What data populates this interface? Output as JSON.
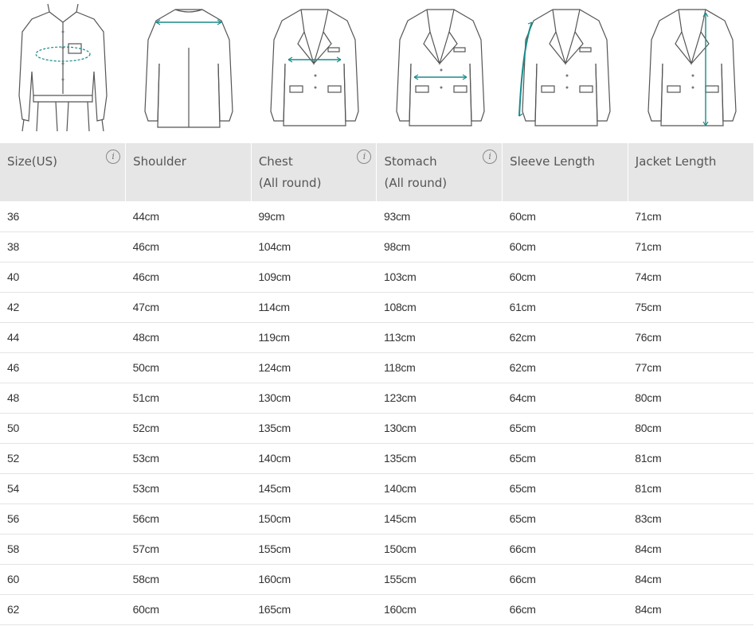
{
  "illustrations": [
    {
      "icon": "shirt-waist-icon"
    },
    {
      "icon": "jacket-back-shoulder-icon"
    },
    {
      "icon": "jacket-chest-icon"
    },
    {
      "icon": "jacket-stomach-icon"
    },
    {
      "icon": "jacket-sleeve-icon"
    },
    {
      "icon": "jacket-length-icon"
    }
  ],
  "accent_color": "#1a8a8a",
  "headers": [
    {
      "label": "Size(US)",
      "sub": "",
      "info": true
    },
    {
      "label": "Shoulder",
      "sub": "",
      "info": false
    },
    {
      "label": "Chest",
      "sub": "(All round)",
      "info": true
    },
    {
      "label": "Stomach",
      "sub": "(All round)",
      "info": true
    },
    {
      "label": "Sleeve Length",
      "sub": "",
      "info": false
    },
    {
      "label": "Jacket Length",
      "sub": "",
      "info": false
    }
  ],
  "rows": [
    [
      "36",
      "44cm",
      "99cm",
      "93cm",
      "60cm",
      "71cm"
    ],
    [
      "38",
      "46cm",
      "104cm",
      "98cm",
      "60cm",
      "71cm"
    ],
    [
      "40",
      "46cm",
      "109cm",
      "103cm",
      "60cm",
      "74cm"
    ],
    [
      "42",
      "47cm",
      "114cm",
      "108cm",
      "61cm",
      "75cm"
    ],
    [
      "44",
      "48cm",
      "119cm",
      "113cm",
      "62cm",
      "76cm"
    ],
    [
      "46",
      "50cm",
      "124cm",
      "118cm",
      "62cm",
      "77cm"
    ],
    [
      "48",
      "51cm",
      "130cm",
      "123cm",
      "64cm",
      "80cm"
    ],
    [
      "50",
      "52cm",
      "135cm",
      "130cm",
      "65cm",
      "80cm"
    ],
    [
      "52",
      "53cm",
      "140cm",
      "135cm",
      "65cm",
      "81cm"
    ],
    [
      "54",
      "53cm",
      "145cm",
      "140cm",
      "65cm",
      "81cm"
    ],
    [
      "56",
      "56cm",
      "150cm",
      "145cm",
      "65cm",
      "83cm"
    ],
    [
      "58",
      "57cm",
      "155cm",
      "150cm",
      "66cm",
      "84cm"
    ],
    [
      "60",
      "58cm",
      "160cm",
      "155cm",
      "66cm",
      "84cm"
    ],
    [
      "62",
      "60cm",
      "165cm",
      "160cm",
      "66cm",
      "84cm"
    ]
  ]
}
